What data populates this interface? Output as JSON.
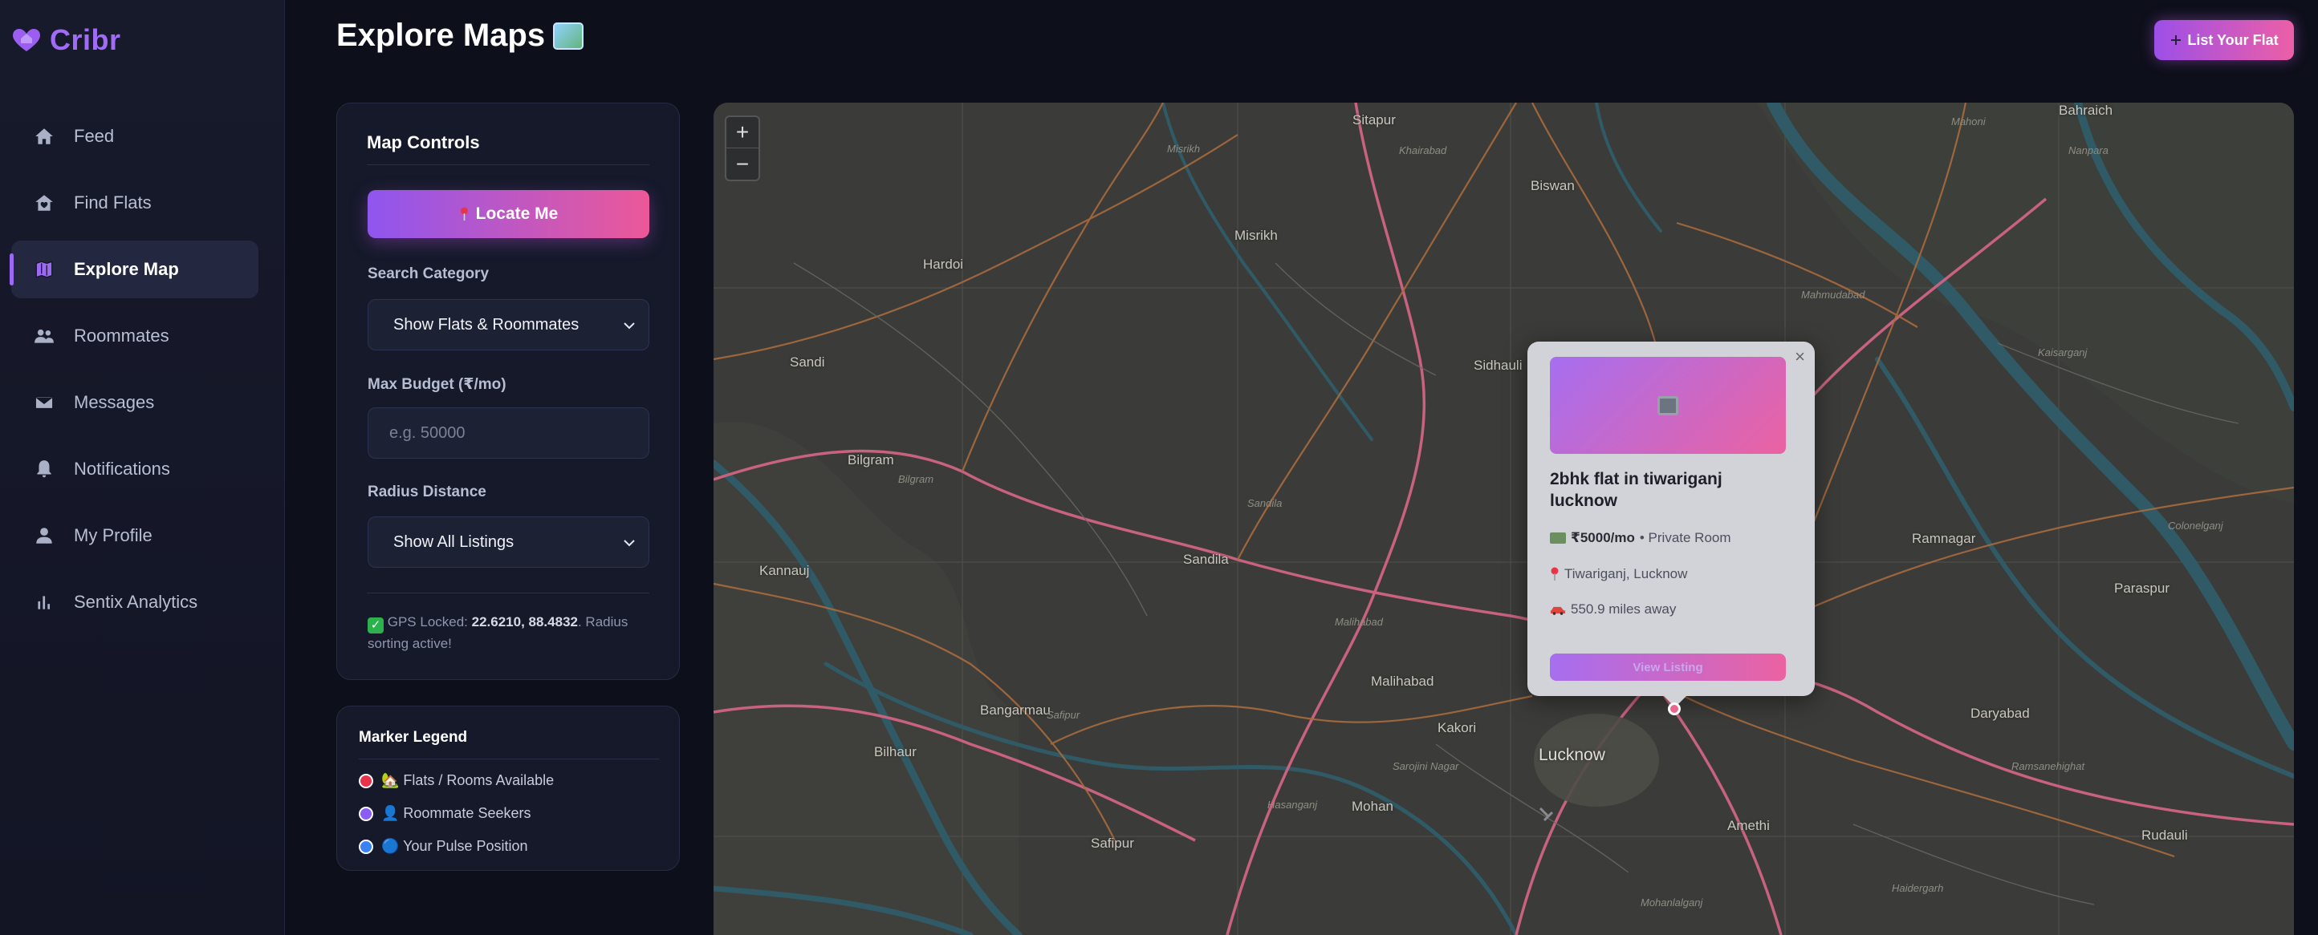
{
  "brand": {
    "name": "Cribr",
    "color": "#a06bf5"
  },
  "nav": [
    {
      "label": "Feed",
      "icon": "home-icon"
    },
    {
      "label": "Find Flats",
      "icon": "house-heart-icon"
    },
    {
      "label": "Explore Map",
      "icon": "map-icon",
      "active": true
    },
    {
      "label": "Roommates",
      "icon": "people-icon"
    },
    {
      "label": "Messages",
      "icon": "mail-icon"
    },
    {
      "label": "Notifications",
      "icon": "bell-icon"
    },
    {
      "label": "My Profile",
      "icon": "person-icon"
    },
    {
      "label": "Sentix Analytics",
      "icon": "bar-chart-icon"
    }
  ],
  "header": {
    "title": "Explore Maps",
    "list_button": "List Your Flat"
  },
  "controls": {
    "title": "Map Controls",
    "locate_button": "Locate Me",
    "category_label": "Search Category",
    "category_value": "Show Flats & Roommates",
    "budget_label": "Max Budget (₹/mo)",
    "budget_placeholder": "e.g. 50000",
    "radius_label": "Radius Distance",
    "radius_value": "Show All Listings",
    "gps_prefix": "GPS Locked: ",
    "gps_coords": "22.6210, 88.4832",
    "gps_suffix": ". Radius sorting active!"
  },
  "legend": {
    "title": "Marker Legend",
    "items": [
      {
        "label": "🏡 Flats / Rooms Available",
        "color": "#e8334a"
      },
      {
        "label": "👤 Roommate Seekers",
        "color": "#8b5cf6"
      },
      {
        "label": "🔵 Your Pulse Position",
        "color": "#3b82f6"
      }
    ]
  },
  "map": {
    "cities": [
      "Sitapur",
      "Hardoi",
      "Lucknow",
      "Bahraich",
      "Sandila",
      "Bilgram",
      "Sandi",
      "Mohan",
      "Safipur",
      "Bangarmau",
      "Kakori",
      "Malihabad",
      "Misrikh",
      "Biswan",
      "Sidhauli",
      "Kannauj",
      "Bilhaur",
      "Amethi",
      "Daryabad",
      "Ramnagar",
      "Paraspur",
      "Rudauli"
    ],
    "towns": [
      "Misrikh",
      "Khairabad",
      "Mahmudabad",
      "Sandila",
      "Bilgram",
      "Safipur",
      "Mohanlalganj",
      "Hasanganj",
      "Haidergarh",
      "Ramsanehighat",
      "Mahoni",
      "Nanpara",
      "Kaisarganj",
      "Colonelganj",
      "Malihabad",
      "Sarojini Nagar"
    ],
    "zoom_in": "+",
    "zoom_out": "−"
  },
  "popup": {
    "title": "2bhk flat in tiwariganj lucknow",
    "price": "₹5000/mo",
    "room_type": "• Private Room",
    "location": "Tiwariganj, Lucknow",
    "distance": "550.9 miles away",
    "button": "View Listing",
    "close": "×"
  }
}
